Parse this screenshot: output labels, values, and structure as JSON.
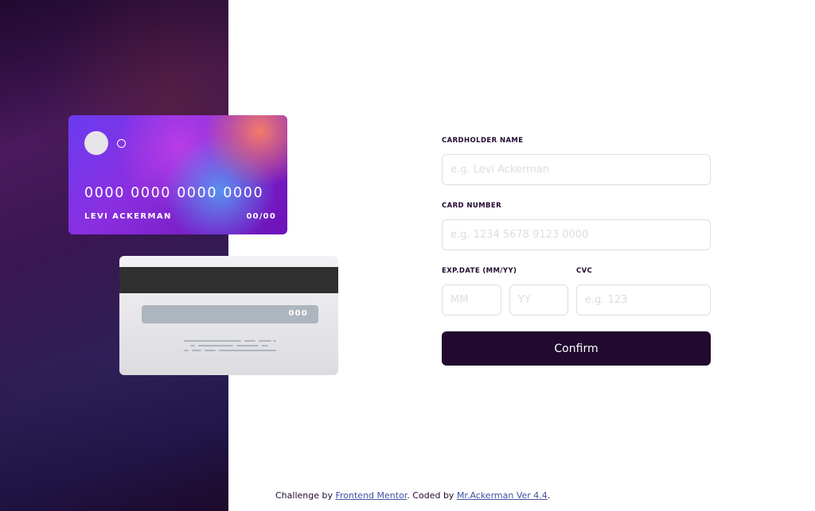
{
  "card_front": {
    "number": "0000 0000 0000 0000",
    "name": "LEVI ACKERMAN",
    "expiry": "00/00"
  },
  "card_back": {
    "cvc": "000"
  },
  "form": {
    "cardholder": {
      "label": "CARDHOLDER NAME",
      "placeholder": "e.g. Levi Ackerman",
      "value": ""
    },
    "number": {
      "label": "CARD NUMBER",
      "placeholder": "e.g. 1234 5678 9123 0000",
      "value": ""
    },
    "expiry": {
      "label": "EXP.DATE (MM/YY)",
      "mm_placeholder": "MM",
      "yy_placeholder": "YY"
    },
    "cvc": {
      "label": "CVC",
      "placeholder": "e.g. 123",
      "value": ""
    },
    "confirm_label": "Confirm"
  },
  "attribution": {
    "prefix": "Challenge by ",
    "link1": "Frontend Mentor",
    "middle": ". Coded by ",
    "link2": "Mr.Ackerman Ver 4.4",
    "suffix": "."
  },
  "colors": {
    "primary_dark": "#21092f",
    "input_border": "#dedddf",
    "link": "#3e52a3"
  }
}
